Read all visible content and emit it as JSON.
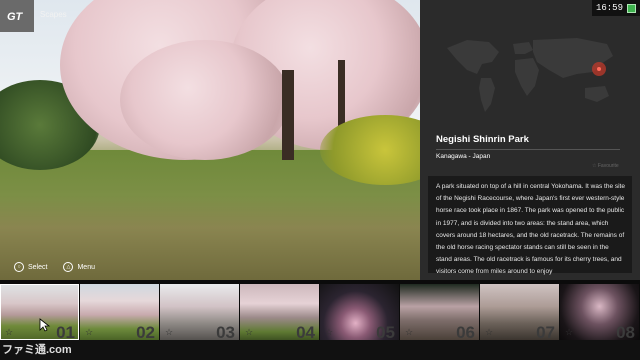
{
  "header": {
    "breadcrumb": "Scapes"
  },
  "status": {
    "time": "16:59"
  },
  "hints": [
    {
      "icon": "circle-button-icon",
      "label": "Select"
    },
    {
      "icon": "triangle-button-icon",
      "label": "Menu"
    }
  ],
  "location": {
    "name": "Negishi Shinrin Park",
    "region": "Kanagawa - Japan",
    "favorite_label": "Favourite",
    "description": "A park situated on top of a hill in central Yokohama. It was the site of the Negishi Racecourse, where Japan's first ever western-style horse race took place in 1867. The park was opened to the public in 1977, and is divided into two areas: the stand area, which covers around 18 hectares, and the old racetrack. The remains of the old horse racing spectator stands can still be seen in the stand areas. The old racetrack is famous for its cherry trees, and visitors come from miles around to enjoy"
  },
  "thumbnails": [
    {
      "num": "01",
      "selected": true
    },
    {
      "num": "02"
    },
    {
      "num": "03"
    },
    {
      "num": "04"
    },
    {
      "num": "05"
    },
    {
      "num": "06"
    },
    {
      "num": "07"
    },
    {
      "num": "08"
    }
  ],
  "watermark": "ファミ通.com",
  "colors": {
    "panel": "#2b2b2b",
    "map_marker": "#c0392b",
    "battery": "#3fb34f"
  }
}
